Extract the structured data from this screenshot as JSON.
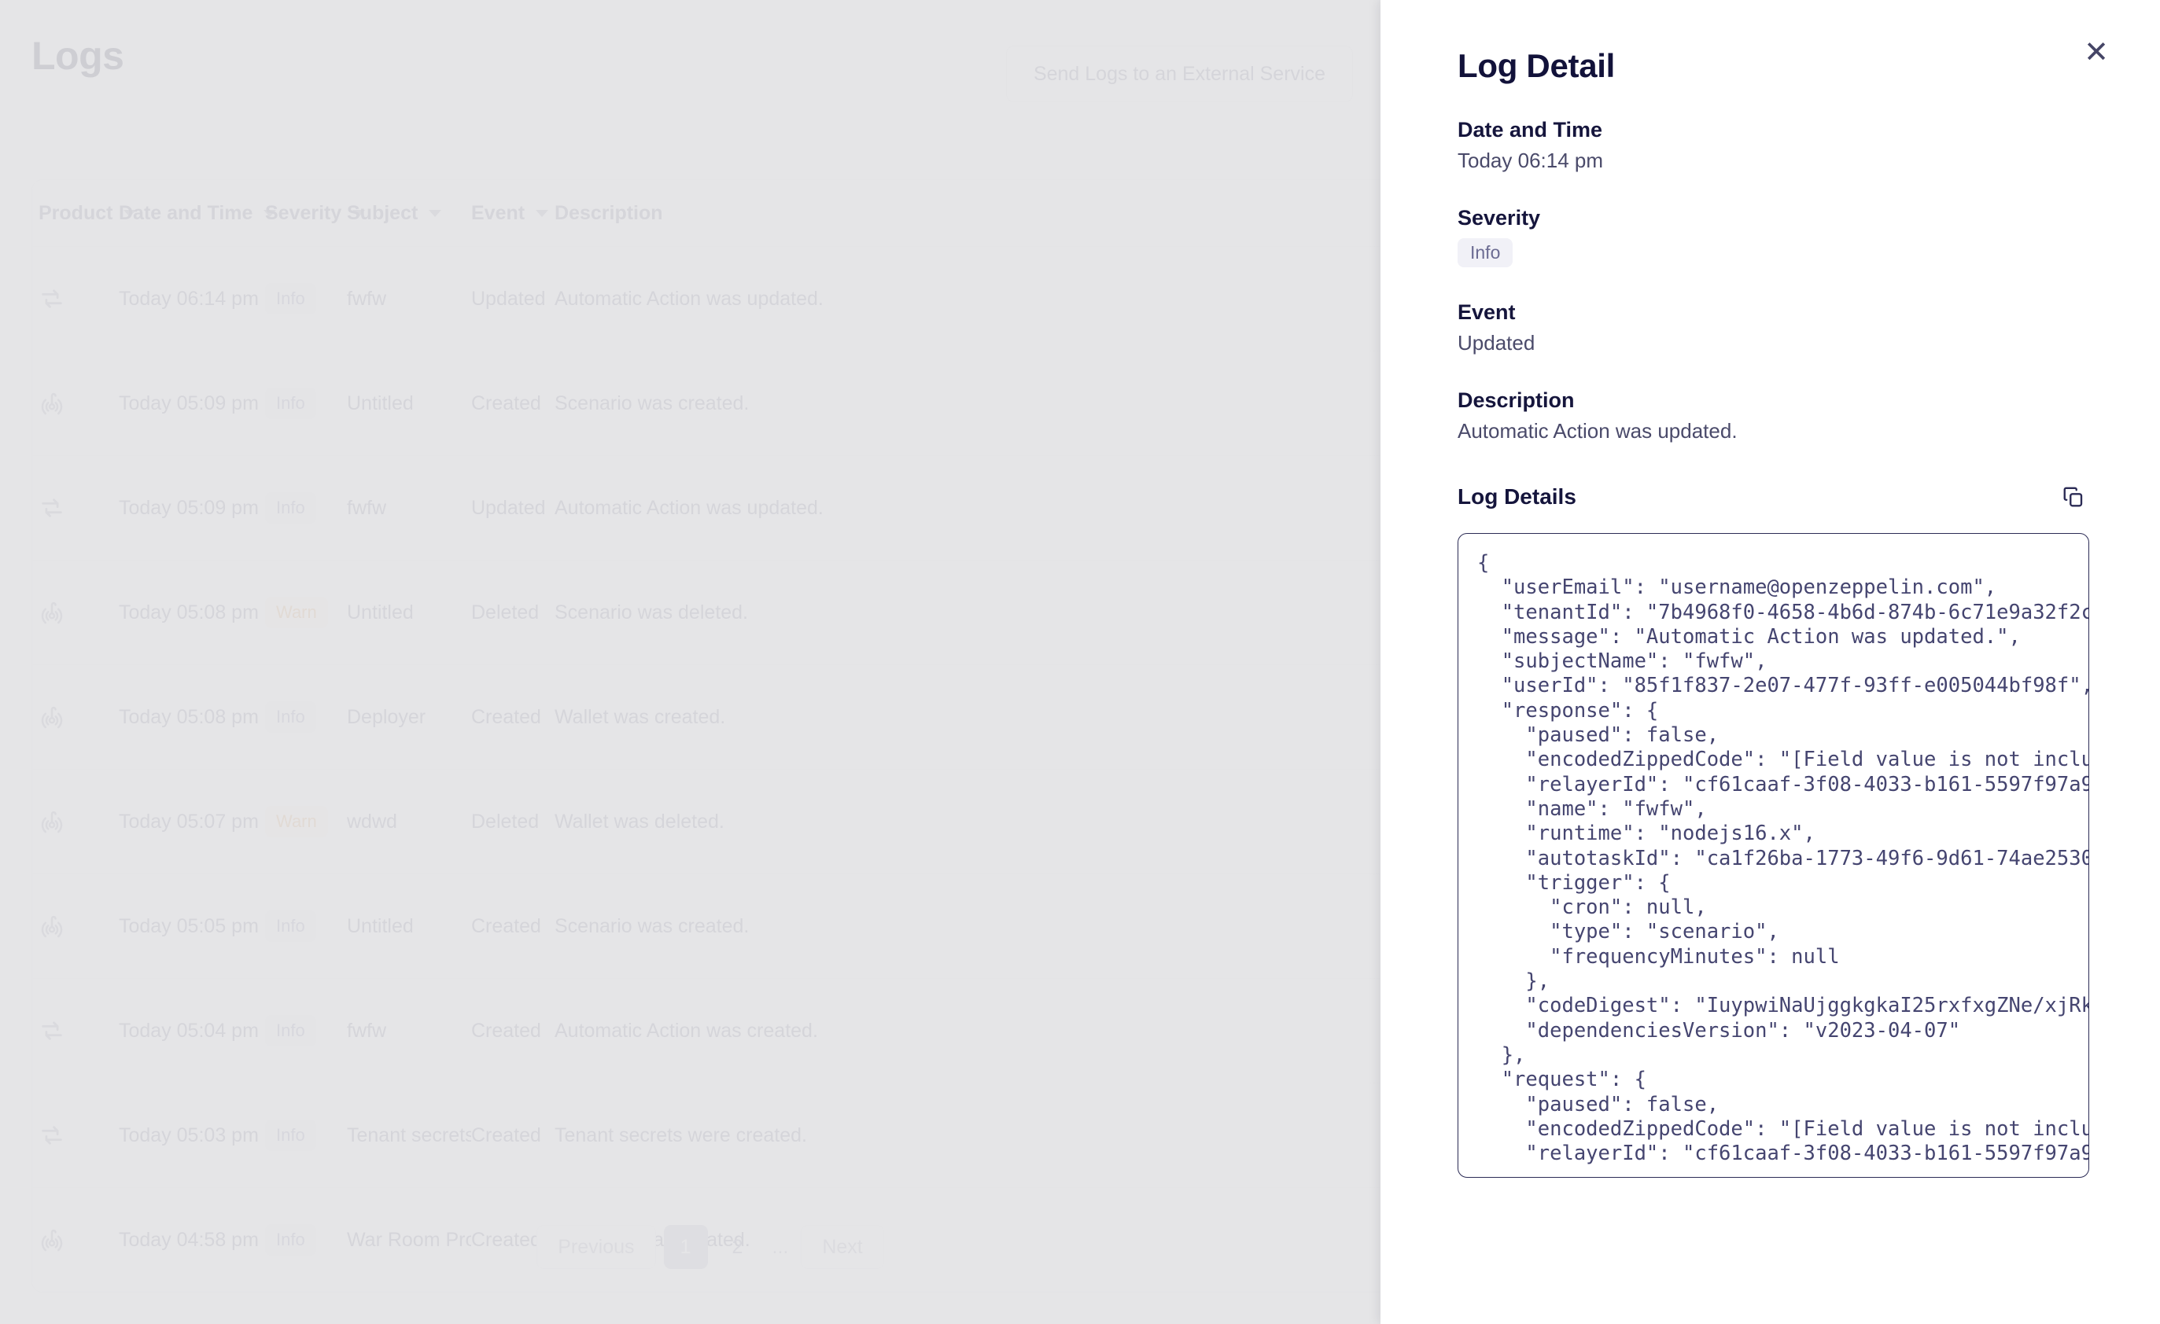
{
  "page": {
    "title": "Logs",
    "external_service_button": "Send Logs to an External Service"
  },
  "table": {
    "columns": [
      {
        "label": "Product",
        "sortable": true
      },
      {
        "label": "Date and Time",
        "sortable": true
      },
      {
        "label": "Severity",
        "sortable": true
      },
      {
        "label": "Subject",
        "sortable": true
      },
      {
        "label": "Event",
        "sortable": true
      },
      {
        "label": "Description",
        "sortable": false
      }
    ],
    "rows": [
      {
        "icon": "repeat-arrows-icon",
        "datetime": "Today 06:14 pm",
        "severity": "Info",
        "severity_kind": "info",
        "subject": "fwfw",
        "event": "Updated",
        "description": "Automatic Action was updated."
      },
      {
        "icon": "sentinel-radar-icon",
        "datetime": "Today 05:09 pm",
        "severity": "Info",
        "severity_kind": "info",
        "subject": "Untitled",
        "event": "Created",
        "description": "Scenario was created."
      },
      {
        "icon": "repeat-arrows-icon",
        "datetime": "Today 05:09 pm",
        "severity": "Info",
        "severity_kind": "info",
        "subject": "fwfw",
        "event": "Updated",
        "description": "Automatic Action was updated."
      },
      {
        "icon": "sentinel-radar-icon",
        "datetime": "Today 05:08 pm",
        "severity": "Warn",
        "severity_kind": "warn",
        "subject": "Untitled",
        "event": "Deleted",
        "description": "Scenario was deleted."
      },
      {
        "icon": "sentinel-radar-icon",
        "datetime": "Today 05:08 pm",
        "severity": "Info",
        "severity_kind": "info",
        "subject": "Deployer",
        "event": "Created",
        "description": "Wallet was created."
      },
      {
        "icon": "sentinel-radar-icon",
        "datetime": "Today 05:07 pm",
        "severity": "Warn",
        "severity_kind": "warn",
        "subject": "wdwd",
        "event": "Deleted",
        "description": "Wallet was deleted."
      },
      {
        "icon": "sentinel-radar-icon",
        "datetime": "Today 05:05 pm",
        "severity": "Info",
        "severity_kind": "info",
        "subject": "Untitled",
        "event": "Created",
        "description": "Scenario was created."
      },
      {
        "icon": "repeat-arrows-icon",
        "datetime": "Today 05:04 pm",
        "severity": "Info",
        "severity_kind": "info",
        "subject": "fwfw",
        "event": "Created",
        "description": "Automatic Action was created."
      },
      {
        "icon": "repeat-arrows-icon",
        "datetime": "Today 05:03 pm",
        "severity": "Info",
        "severity_kind": "info",
        "subject": "Tenant secrets",
        "event": "Created",
        "description": "Tenant secrets were created."
      },
      {
        "icon": "sentinel-radar-icon",
        "datetime": "Today 04:58 pm",
        "severity": "Info",
        "severity_kind": "info",
        "subject": "War Room Proced...",
        "event": "Created",
        "description": "Runbook was created."
      }
    ]
  },
  "pagination": {
    "previous_label": "Previous",
    "next_label": "Next",
    "pages": [
      "1",
      "2"
    ],
    "ellipsis": "...",
    "current_page": "1"
  },
  "drawer": {
    "title": "Log Detail",
    "close_label": "✕",
    "fields": [
      {
        "label": "Date and Time",
        "value": "Today 06:14 pm",
        "type": "text"
      },
      {
        "label": "Severity",
        "value": "Info",
        "type": "badge"
      },
      {
        "label": "Event",
        "value": "Updated",
        "type": "text"
      },
      {
        "label": "Description",
        "value": "Automatic Action was updated.",
        "type": "text"
      }
    ],
    "log_details_label": "Log Details",
    "copy_icon": "copy-icon",
    "log_json": "{\n  \"userEmail\": \"username@openzeppelin.com\",\n  \"tenantId\": \"7b4968f0-4658-4b6d-874b-6c71e9a32f2c\",\n  \"message\": \"Automatic Action was updated.\",\n  \"subjectName\": \"fwfw\",\n  \"userId\": \"85f1f837-2e07-477f-93ff-e005044bf98f\",\n  \"response\": {\n    \"paused\": false,\n    \"encodedZippedCode\": \"[Field value is not included\n    \"relayerId\": \"cf61caaf-3f08-4033-b161-5597f97a971\n    \"name\": \"fwfw\",\n    \"runtime\": \"nodejs16.x\",\n    \"autotaskId\": \"ca1f26ba-1773-49f6-9d61-74ae253088\n    \"trigger\": {\n      \"cron\": null,\n      \"type\": \"scenario\",\n      \"frequencyMinutes\": null\n    },\n    \"codeDigest\": \"IuypwiNaUjggkgkaI25rxfxgZNe/xjRkXE\n    \"dependenciesVersion\": \"v2023-04-07\"\n  },\n  \"request\": {\n    \"paused\": false,\n    \"encodedZippedCode\": \"[Field value is not include\n    \"relayerId\": \"cf61caaf-3f08-4033-b161-5597f97a971"
  },
  "colors": {
    "accent_dark": "#12123a",
    "muted_text": "#5b5b78",
    "info_badge_bg": "#eeeef5",
    "info_badge_fg": "#6f6f95",
    "warn_badge_bg": "#fbf0e4",
    "warn_badge_fg": "#d48a3f",
    "code_text": "#454570",
    "pagination_active_bg": "#b4b4c6"
  }
}
